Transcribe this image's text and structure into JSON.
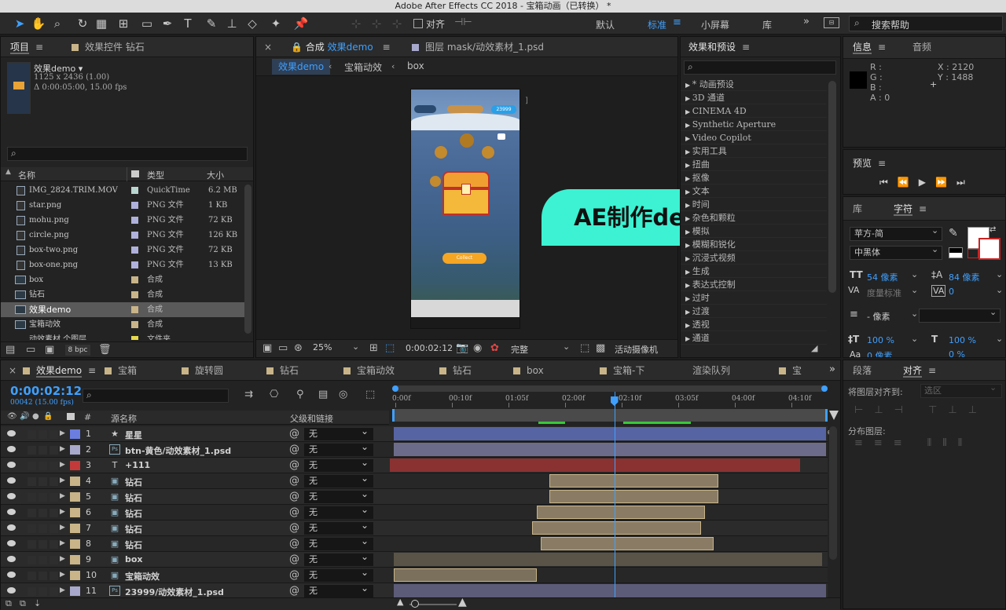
{
  "window": {
    "title": "Adobe After Effects CC 2018 - 宝箱动画（已转换） *"
  },
  "toolbar": {
    "snap_label": "对齐",
    "workspaces": [
      "默认",
      "标准",
      "小屏幕",
      "库"
    ],
    "active_workspace": "标准",
    "search_placeholder": "搜索帮助"
  },
  "project": {
    "tabs": [
      "项目",
      "效果控件 钻石"
    ],
    "selected_name": "效果demo ▾",
    "selected_size": "1125 x 2436 (1.00)",
    "selected_duration": "Δ 0:00:05:00, 15.00 fps",
    "columns": [
      "名称",
      "类型",
      "大小"
    ],
    "items": [
      {
        "name": "IMG_2824.TRIM.MOV",
        "type": "QuickTime",
        "size": "6.2 MB",
        "color": "#b9d6d0",
        "kind": "file"
      },
      {
        "name": "star.png",
        "type": "PNG 文件",
        "size": "1 KB",
        "color": "#b0b0dc",
        "kind": "file"
      },
      {
        "name": "mohu.png",
        "type": "PNG 文件",
        "size": "72 KB",
        "color": "#b0b0dc",
        "kind": "file"
      },
      {
        "name": "circle.png",
        "type": "PNG 文件",
        "size": "126 KB",
        "color": "#b0b0dc",
        "kind": "file"
      },
      {
        "name": "box-two.png",
        "type": "PNG 文件",
        "size": "72 KB",
        "color": "#b0b0dc",
        "kind": "file"
      },
      {
        "name": "box-one.png",
        "type": "PNG 文件",
        "size": "13 KB",
        "color": "#b0b0dc",
        "kind": "file"
      },
      {
        "name": "box",
        "type": "合成",
        "size": "",
        "color": "#c8b488",
        "kind": "comp"
      },
      {
        "name": "钻石",
        "type": "合成",
        "size": "",
        "color": "#c8b488",
        "kind": "comp"
      },
      {
        "name": "效果demo",
        "type": "合成",
        "size": "",
        "color": "#c8b488",
        "kind": "comp"
      },
      {
        "name": "宝箱动效",
        "type": "合成",
        "size": "",
        "color": "#c8b488",
        "kind": "comp"
      },
      {
        "name": "动效素材 个图层",
        "type": "文件夹",
        "size": "",
        "color": "#e6d84a",
        "kind": "folder"
      }
    ],
    "bpc": "8 bpc"
  },
  "composition": {
    "tab_label": "合成",
    "tab_name": "效果demo",
    "layer_tab": "图层 mask/动效素材_1.psd",
    "breadcrumbs": [
      "效果demo",
      "宝箱动效",
      "box"
    ],
    "overlay_text": "AE制作demo",
    "phone_badge": "23999",
    "phone_button": "Collect",
    "zoom": "25%",
    "timecode": "0:00:02:12",
    "resolution": "完整",
    "camera": "活动摄像机"
  },
  "effects": {
    "title": "效果和预设",
    "items": [
      "* 动画预设",
      "3D 通道",
      "CINEMA 4D",
      "Synthetic Aperture",
      "Video Copilot",
      "实用工具",
      "扭曲",
      "抠像",
      "文本",
      "时间",
      "杂色和颗粒",
      "模拟",
      "模糊和锐化",
      "沉浸式视频",
      "生成",
      "表达式控制",
      "过时",
      "过渡",
      "透视",
      "通道"
    ]
  },
  "info": {
    "tabs": [
      "信息",
      "音频"
    ],
    "r": "R :",
    "g": "G :",
    "b": "B :",
    "a": "A : 0",
    "x": "X : 2120",
    "y": "Y : 1488"
  },
  "preview": {
    "title": "预览"
  },
  "character": {
    "tabs": [
      "库",
      "字符"
    ],
    "font": "苹方-简",
    "style": "中黑体",
    "size": "54 像素",
    "leading": "84 像素",
    "kerning": "度量标准",
    "tracking": "0",
    "stroke": "- 像素",
    "vscale": "100 %",
    "hscale": "100 %",
    "baseline": "0 像素",
    "tsume": "0 %"
  },
  "align": {
    "tabs": [
      "段落",
      "对齐"
    ],
    "align_to_label": "将图层对齐到:",
    "align_to_value": "选区",
    "distribute_label": "分布图层:"
  },
  "timeline": {
    "tabs": [
      "效果demo",
      "宝箱",
      "旋转圆",
      "钻石",
      "宝箱动效",
      "钻石",
      "box",
      "宝箱-下",
      "渲染队列",
      "宝"
    ],
    "tab_colors": [
      "#c8b488",
      "#c8b488",
      "#c8b488",
      "#c8b488",
      "#c8b488",
      "#c8b488",
      "#c8b488",
      "#c8b488",
      "",
      "#c8b488"
    ],
    "timecode": "0:00:02:12",
    "frame_info": "00042 (15.00 fps)",
    "col_source": "源名称",
    "col_parent": "父级和链接",
    "ruler": [
      "0:00f",
      "00:10f",
      "01:05f",
      "02:00f",
      "02:10f",
      "03:05f",
      "04:00f",
      "04:10f"
    ],
    "playhead_fraction": 0.51,
    "layers": [
      {
        "num": "1",
        "icon": "★",
        "name": "星星",
        "label": "#6b7ee0",
        "parent": "无",
        "bar": [
          0.0,
          1.0
        ],
        "barcolor": "#5764a4"
      },
      {
        "num": "2",
        "icon": "Ps",
        "name": "btn-黄色/动效素材_1.psd",
        "label": "#a8a8cc",
        "parent": "无",
        "bar": [
          0.0,
          1.0
        ],
        "barcolor": "#6c6c8a"
      },
      {
        "num": "3",
        "icon": "T",
        "name": "+111",
        "label": "#c43a3a",
        "parent": "无",
        "bar": [
          -0.01,
          0.94
        ],
        "barcolor": "#8a3232"
      },
      {
        "num": "4",
        "icon": "▣",
        "name": "钻石",
        "label": "#c8b488",
        "parent": "无",
        "bar": [
          0.36,
          0.75
        ],
        "barcolor": "#8a7c64"
      },
      {
        "num": "5",
        "icon": "▣",
        "name": "钻石",
        "label": "#c8b488",
        "parent": "无",
        "bar": [
          0.36,
          0.75
        ],
        "barcolor": "#8a7c64"
      },
      {
        "num": "6",
        "icon": "▣",
        "name": "钻石",
        "label": "#c8b488",
        "parent": "无",
        "bar": [
          0.33,
          0.72
        ],
        "barcolor": "#8a7c64"
      },
      {
        "num": "7",
        "icon": "▣",
        "name": "钻石",
        "label": "#c8b488",
        "parent": "无",
        "bar": [
          0.32,
          0.71
        ],
        "barcolor": "#8a7c64"
      },
      {
        "num": "8",
        "icon": "▣",
        "name": "钻石",
        "label": "#c8b488",
        "parent": "无",
        "bar": [
          0.34,
          0.74
        ],
        "barcolor": "#8a7c64"
      },
      {
        "num": "9",
        "icon": "▣",
        "name": "box",
        "label": "#c8b488",
        "parent": "无",
        "bar": [
          0.0,
          0.99
        ],
        "barcolor": "#5a5448"
      },
      {
        "num": "10",
        "icon": "▣",
        "name": "宝箱动效",
        "label": "#c8b488",
        "parent": "无",
        "bar": [
          0.0,
          0.33
        ],
        "barcolor": "#7a705c"
      },
      {
        "num": "11",
        "icon": "Ps",
        "name": "23999/动效素材_1.psd",
        "label": "#a8a8cc",
        "parent": "无",
        "bar": [
          0.0,
          1.0
        ],
        "barcolor": "#5c5c78"
      }
    ]
  }
}
